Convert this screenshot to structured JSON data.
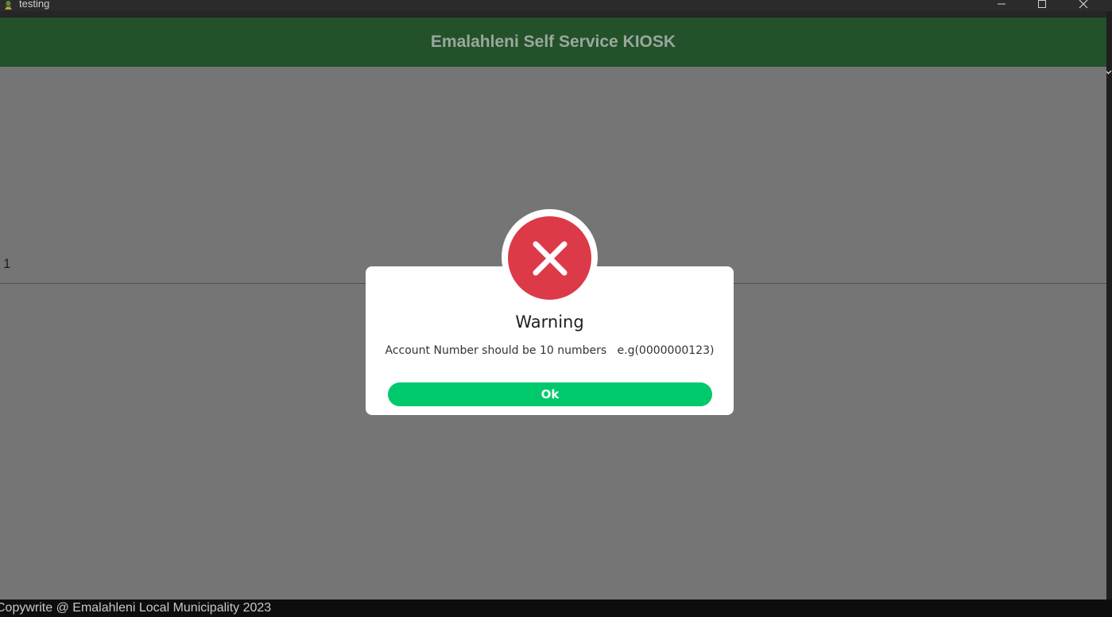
{
  "window": {
    "title": "testing",
    "app_icon": "municipality-logo-icon"
  },
  "header": {
    "title": "Emalahleni Self Service KIOSK"
  },
  "content": {
    "row_number": "1"
  },
  "dialog": {
    "icon": "error-x-icon",
    "title": "Warning",
    "message": "Account Number should be 10 numbers   e.g(0000000123)",
    "ok_label": "Ok"
  },
  "footer": {
    "copyright": "Copywrite @ Emalahleni Local Municipality 2023"
  },
  "colors": {
    "header_bg": "#23512a",
    "overlay_bg": "#757575",
    "error_red": "#dc3a48",
    "ok_green": "#00c96b"
  }
}
